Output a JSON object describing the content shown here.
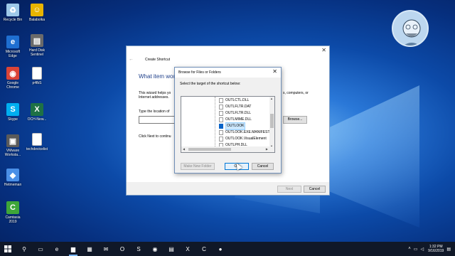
{
  "desktop": {
    "icons": [
      {
        "label": "Recycle Bin",
        "icon": "recycle-bin-icon",
        "color": "#9ec9e8",
        "glyph": "♻"
      },
      {
        "label": "Balabolka",
        "icon": "balabolka-icon",
        "color": "#e8b400",
        "glyph": "☺"
      },
      {
        "label": "Microsoft\nEdge",
        "icon": "edge-icon",
        "color": "#1f6fd1",
        "glyph": "e"
      },
      {
        "label": "Hard Disk\nSentinel",
        "icon": "hard-disk-sentinel-icon",
        "color": "#6a6a6a",
        "glyph": "▤"
      },
      {
        "label": "Google\nChrome",
        "icon": "chrome-icon",
        "color": "#db4437",
        "glyph": "◉"
      },
      {
        "label": "p4fbS",
        "icon": "document-icon",
        "color": "#ffffff",
        "glyph": ""
      },
      {
        "label": "Skype",
        "icon": "skype-icon",
        "color": "#00aff0",
        "glyph": "S"
      },
      {
        "label": "OCH-New...",
        "icon": "excel-icon",
        "color": "#1e7145",
        "glyph": "X"
      },
      {
        "label": "VMware\nWorksta...",
        "icon": "vmware-icon",
        "color": "#5a5a5a",
        "glyph": "▣"
      },
      {
        "label": "techdevicelist",
        "icon": "document-icon",
        "color": "#ffffff",
        "glyph": ""
      },
      {
        "label": "Hetmeman",
        "icon": "app-icon",
        "color": "#4a8fe7",
        "glyph": "◆"
      },
      {
        "label": "Camtasia\n2019",
        "icon": "camtasia-icon",
        "color": "#3ea639",
        "glyph": "C"
      }
    ]
  },
  "wizard": {
    "title": "Create Shortcut",
    "close": "✕",
    "back": "←",
    "heading": "What item wou",
    "intro": "This wizard helps yo\nInternet addresses.",
    "intro_right": "s, computers, or",
    "location_label": "Type the location of",
    "browse_label": "Browse...",
    "click_next": "Click Next to continu",
    "next_label": "Next",
    "cancel_label": "Cancel"
  },
  "browse_dialog": {
    "title": "Browse for Files or Folders",
    "close": "✕",
    "prompt": "Select the target of the shortcut below:",
    "items": [
      "OUTLCTL.DLL",
      "OUTLFLTR.DAT",
      "OUTLFLTR.DLL",
      "OUTLMIME.DLL",
      "OUTLOOK",
      "OUTLOOK.EXE.MANIFEST",
      "OUTLOOK.VisualElement",
      "OUTLPH.DLL"
    ],
    "selected_index": 4,
    "new_folder_label": "Make New Folder",
    "ok_label": "OK",
    "cancel_label": "Cancel"
  },
  "taskbar": {
    "start_icon": "windows-start-icon",
    "time": "1:32 PM",
    "date": "9/16/2019",
    "items": [
      {
        "icon": "search-icon",
        "glyph": "⚲",
        "active": false
      },
      {
        "icon": "task-view-icon",
        "glyph": "▭",
        "active": false
      },
      {
        "icon": "edge-icon",
        "glyph": "e",
        "active": false
      },
      {
        "icon": "file-explorer-icon",
        "glyph": "▆",
        "active": true
      },
      {
        "icon": "store-icon",
        "glyph": "▦",
        "active": false
      },
      {
        "icon": "mail-icon",
        "glyph": "✉",
        "active": false
      },
      {
        "icon": "outlook-icon",
        "glyph": "O",
        "active": false
      },
      {
        "icon": "skype-icon",
        "glyph": "S",
        "active": false
      },
      {
        "icon": "chrome-icon",
        "glyph": "◉",
        "active": false
      },
      {
        "icon": "app-icon",
        "glyph": "▤",
        "active": false
      },
      {
        "icon": "excel-icon",
        "glyph": "X",
        "active": false
      },
      {
        "icon": "camtasia-icon",
        "glyph": "C",
        "active": false
      },
      {
        "icon": "recorder-icon",
        "glyph": "●",
        "active": false
      }
    ]
  }
}
